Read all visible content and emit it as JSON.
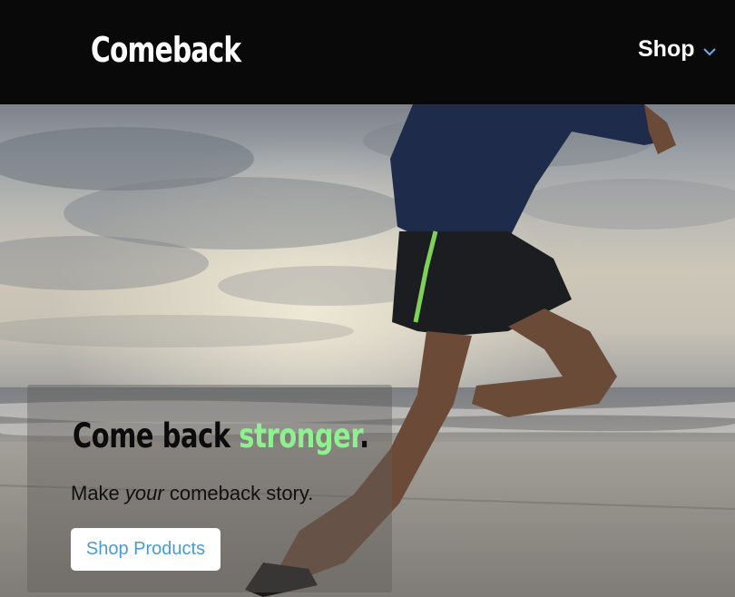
{
  "header": {
    "brand": "Comeback",
    "nav_shop_label": "Shop"
  },
  "hero": {
    "headline_prefix": "Come back ",
    "headline_accent": "stronger",
    "headline_suffix": ".",
    "subline_prefix": "Make ",
    "subline_emphasis": "your",
    "subline_suffix": " comeback story.",
    "cta_label": "Shop Products"
  },
  "colors": {
    "header_bg": "#0a0909",
    "accent_green": "#8ef08f",
    "cta_text": "#4a9ad6",
    "chevron": "#6aaee8"
  }
}
